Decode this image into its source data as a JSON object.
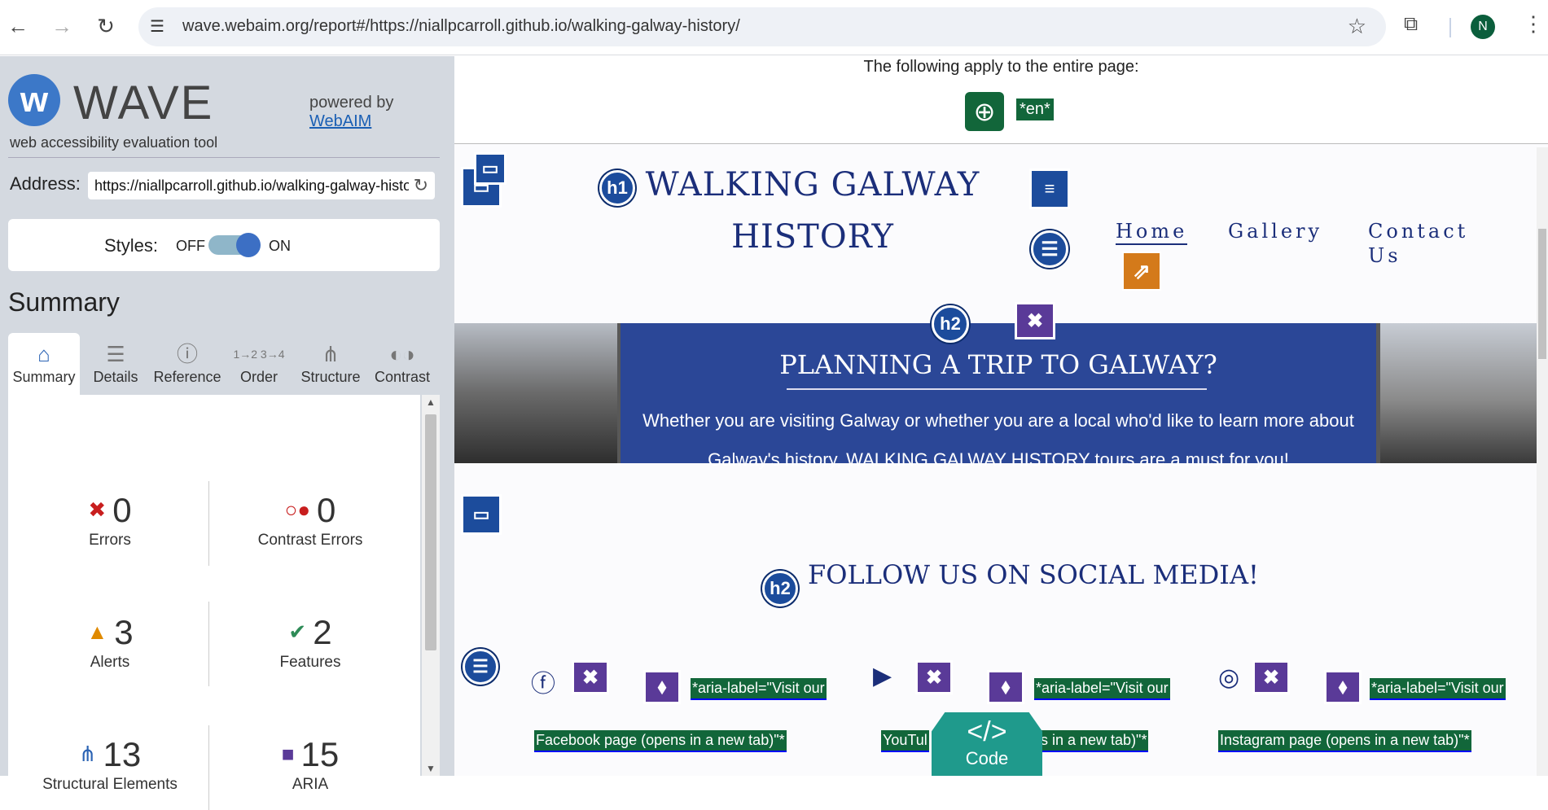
{
  "browser": {
    "url": "wave.webaim.org/report#/https://niallpcarroll.github.io/walking-galway-history/",
    "avatar_letter": "N"
  },
  "wave": {
    "logo_word": "WAVE",
    "logo_sub": "web accessibility evaluation tool",
    "powered_by": "powered by",
    "webaim_link": "WebAIM",
    "address_label": "Address:",
    "address_value": "https://niallpcarroll.github.io/walking-galway-history/",
    "styles_label": "Styles:",
    "styles_off": "OFF",
    "styles_on": "ON",
    "summary_title": "Summary",
    "tabs": [
      {
        "label": "Summary",
        "icon": "home-icon"
      },
      {
        "label": "Details",
        "icon": "list-icon"
      },
      {
        "label": "Reference",
        "icon": "info-icon"
      },
      {
        "label": "Order",
        "icon": "order-icon"
      },
      {
        "label": "Structure",
        "icon": "structure-icon"
      },
      {
        "label": "Contrast",
        "icon": "contrast-icon"
      }
    ],
    "stats": {
      "errors": {
        "count": "0",
        "label": "Errors"
      },
      "contrast": {
        "count": "0",
        "label": "Contrast Errors"
      },
      "alerts": {
        "count": "3",
        "label": "Alerts"
      },
      "features": {
        "count": "2",
        "label": "Features"
      },
      "structural": {
        "count": "13",
        "label": "Structural Elements"
      },
      "aria": {
        "count": "15",
        "label": "ARIA"
      }
    }
  },
  "page": {
    "apply_text": "The following apply to the entire page:",
    "lang_tag": "*en*",
    "site_title": "WALKING GALWAY HISTORY",
    "nav": [
      "Home",
      "Gallery",
      "Contact Us"
    ],
    "hero_title": "PLANNING A TRIP TO GALWAY?",
    "hero_text": "Whether you are visiting Galway or whether you are a local who'd like to learn more about Galway's history, WALKING GALWAY HISTORY tours are a must for you!",
    "follow_title": "FOLLOW US ON SOCIAL MEDIA!",
    "aria_tag_1": "*aria-label=\"Visit our",
    "aria_tag_2": "*aria-label=\"Visit our",
    "aria_tag_3": "*aria-label=\"Visit our",
    "fb_tag": "Facebook page (opens in a new tab)\"*",
    "yt_tag_a": "YouTul",
    "yt_tag_b": "s in a new tab)\"*",
    "ig_tag": "Instagram page (opens in a new tab)\"*",
    "code_label": "Code",
    "code_symbol": "</>"
  },
  "colors": {
    "wave_blue": "#3c78c8",
    "feature_green": "#12663a",
    "aria_purple": "#5a3a98",
    "hero_blue": "#2b4797",
    "title_navy": "#1b2e7a",
    "code_teal": "#1f9a8c"
  }
}
